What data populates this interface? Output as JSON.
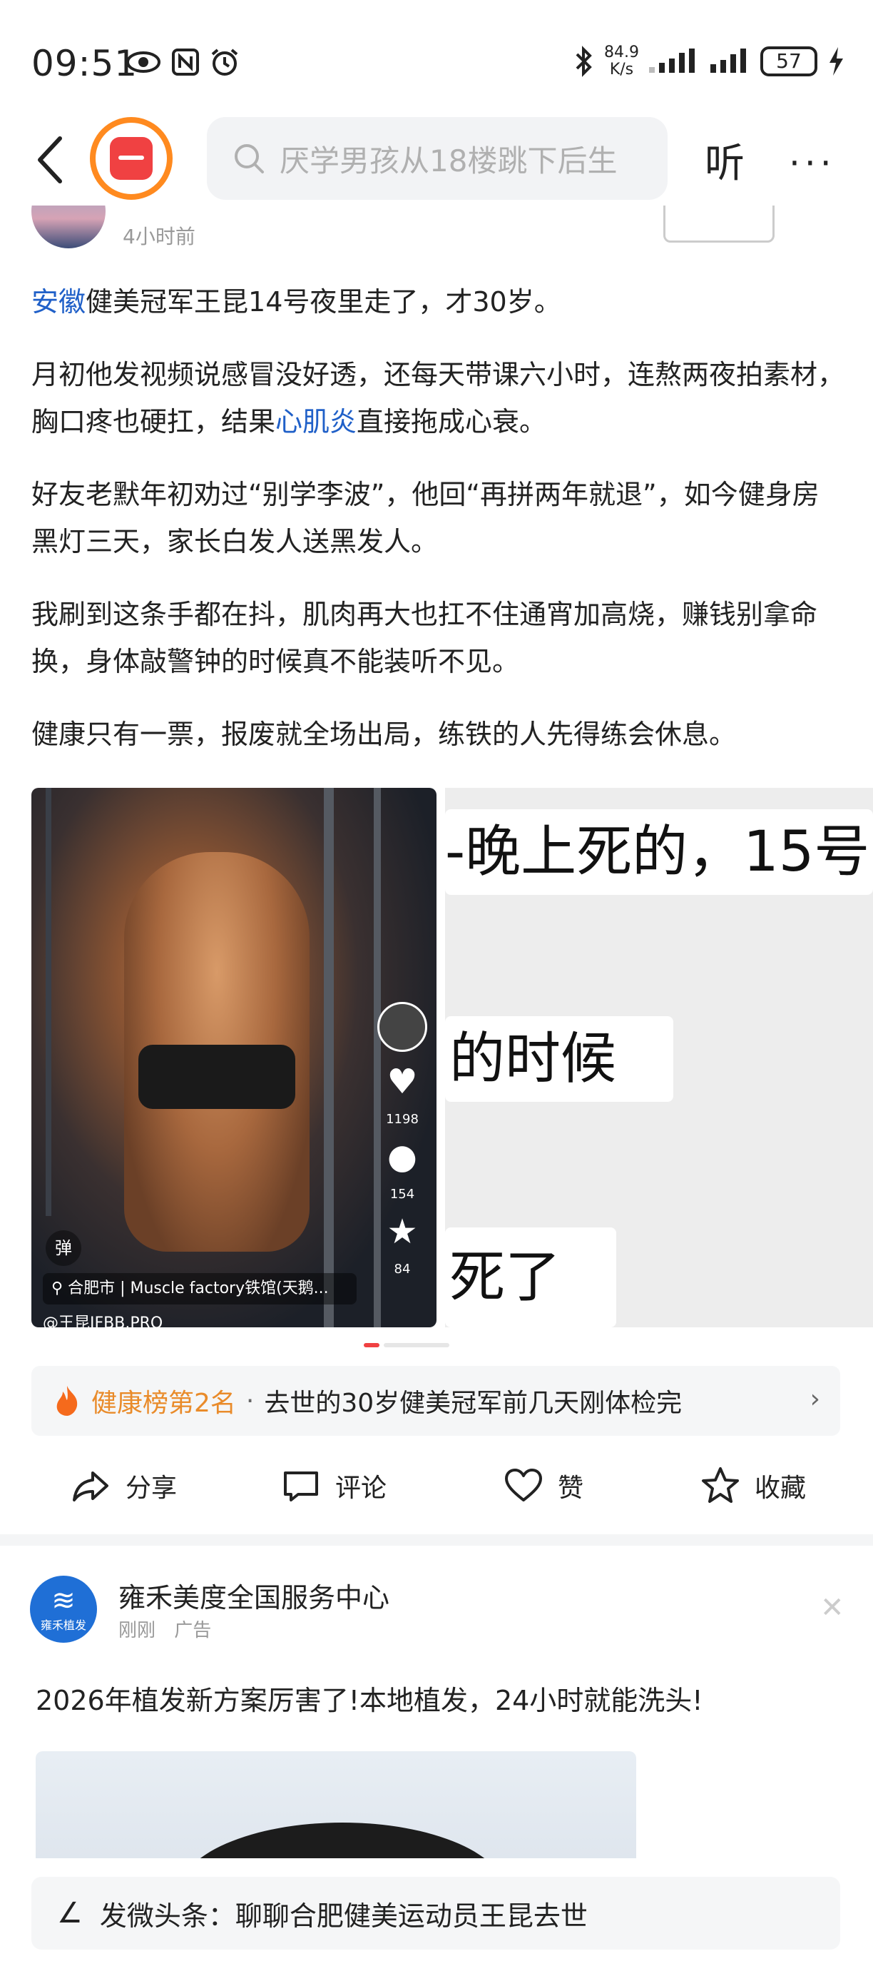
{
  "status_bar": {
    "time": "09:51",
    "net_speed_value": "84.9",
    "net_speed_unit": "K/s",
    "battery": "57"
  },
  "header": {
    "search_placeholder": "厌学男孩从18楼跳下后生",
    "listen_label": "听",
    "more_label": "···"
  },
  "author": {
    "time": "4小时前"
  },
  "article": {
    "p1_link": "安徽",
    "p1_rest": "健美冠军王昆14号夜里走了，才30岁。",
    "p2_a": "月初他发视频说感冒没好透，还每天带课六小时，连熬两夜拍素材，胸口疼也硬扛，结果",
    "p2_link": "心肌炎",
    "p2_b": "直接拖成心衰。",
    "p3": "好友老默年初劝过“别学李波”，他回“再拼两年就退”，如今健身房黑灯三天，家长白发人送黑发人。",
    "p4": "我刷到这条手都在抖，肌肉再大也扛不住通宵加高烧，赚钱别拿命换，身体敲警钟的时候真不能装听不见。",
    "p5": "健康只有一票，报废就全场出局，练铁的人先得练会休息。"
  },
  "image1": {
    "likes": "1198",
    "comments": "154",
    "stars": "84",
    "danmu": "弹",
    "location": "合肥市 | Muscle factory铁馆(天鹅...",
    "watermark": "@王昆JFBB.PRO"
  },
  "image2": {
    "line1": "-晚上死的，15号",
    "line2": "的时候",
    "line3": "死了"
  },
  "rank": {
    "label": "健康榜第2名",
    "separator": "·",
    "text": "去世的30岁健美冠军前几天刚体检完"
  },
  "actions": {
    "share": "分享",
    "comment": "评论",
    "like": "赞",
    "collect": "收藏"
  },
  "ad": {
    "logo_text": "雍禾植发",
    "name": "雍禾美度全国服务中心",
    "meta_time": "刚刚",
    "meta_tag": "广告",
    "text": "2026年植发新方案厉害了!本地植发，24小时就能洗头!"
  },
  "comment_bar": {
    "text": "发微头条：聊聊合肥健美运动员王昆去世"
  },
  "colors": {
    "link": "#2060c8",
    "rank_orange": "#e98b2a",
    "brand_red": "#f04142",
    "ad_blue": "#1f6fd6"
  }
}
